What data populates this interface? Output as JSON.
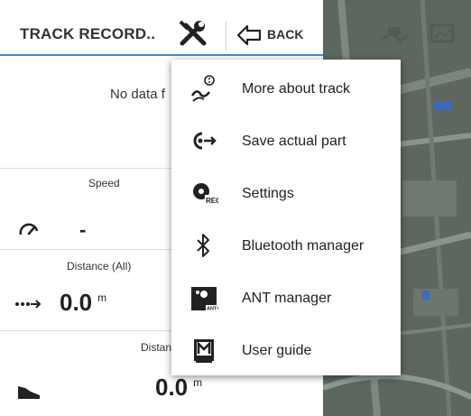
{
  "toolbar": {
    "title": "TRACK RECORD..",
    "tools_icon": "tools-icon",
    "back_label": "BACK"
  },
  "content": {
    "no_data_text": "No data f",
    "speed_label": "Speed",
    "speed_value": "-",
    "distance_all_label": "Distance (All)",
    "distance_all_value": "0.0",
    "distance_all_unit": "m",
    "distance_label": "Distanc",
    "distance_value": "0.0",
    "distance_unit": "m"
  },
  "menu": {
    "items": [
      {
        "label": "More about track",
        "icon": "track-info-icon"
      },
      {
        "label": "Save actual part",
        "icon": "save-part-icon"
      },
      {
        "label": "Settings",
        "icon": "settings-icon"
      },
      {
        "label": "Bluetooth manager",
        "icon": "bluetooth-icon"
      },
      {
        "label": "ANT manager",
        "icon": "ant-icon"
      },
      {
        "label": "User guide",
        "icon": "manual-icon"
      }
    ]
  },
  "colors": {
    "accent": "#3f8fd0",
    "map_bg": "#5f6a63"
  }
}
